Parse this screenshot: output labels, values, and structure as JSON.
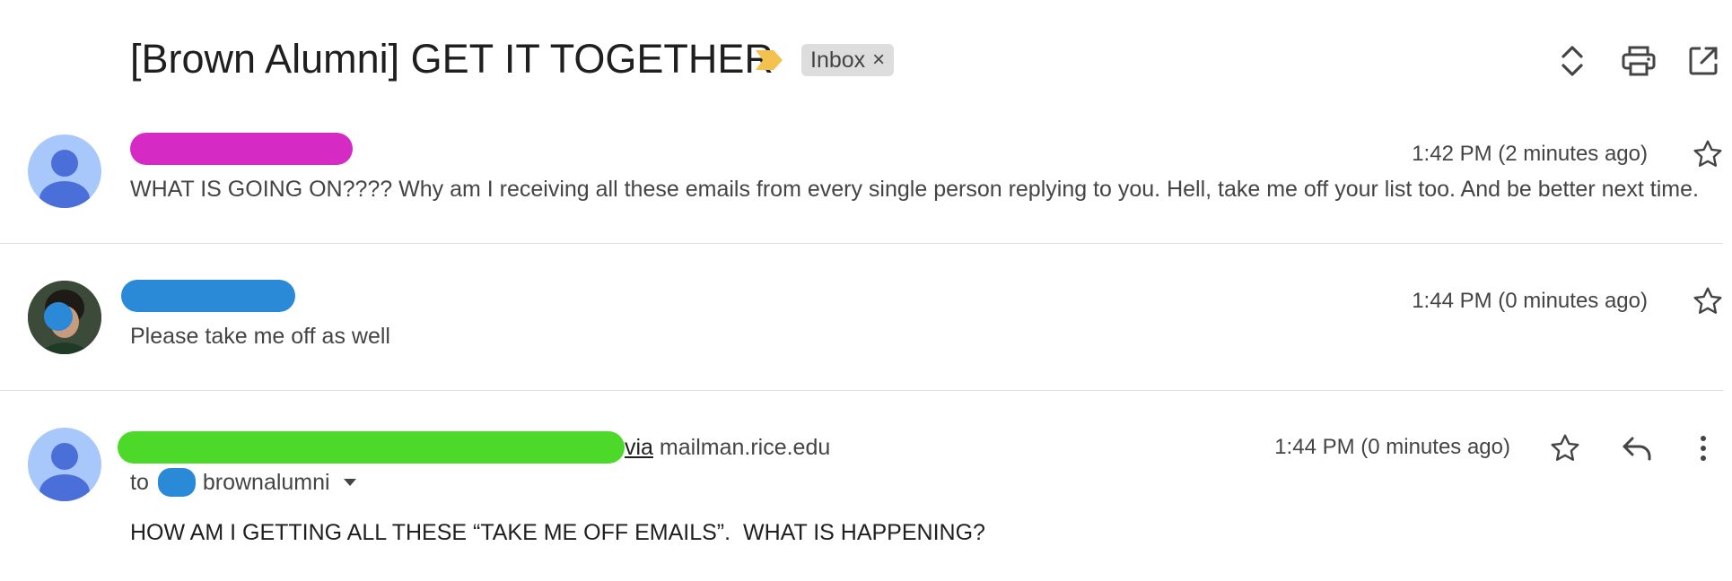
{
  "thread": {
    "subject": "[Brown Alumni] GET IT TOGETHER",
    "label": "Inbox",
    "label_remove": "×",
    "label_arrow_color": "#f2c14e"
  },
  "toolbar": {
    "expand_icon": "unfold-more-icon",
    "print_icon": "print-icon",
    "open_new_window_icon": "open-in-new-icon"
  },
  "messages": [
    {
      "sender_redaction_color": "#d62ac4",
      "time": "1:42 PM (2 minutes ago)",
      "snippet": "WHAT IS GOING ON???? Why am I receiving all these emails from every single person replying to you. Hell, take me off your list too. And be better next time."
    },
    {
      "sender_redaction_color": "#2a8ad8",
      "time": "1:44 PM (0 minutes ago)",
      "snippet": "Please take me off as well"
    },
    {
      "sender_redaction_color": "#4cd92a",
      "via_word": "via",
      "via_domain": " mailman.rice.edu",
      "time": "1:44 PM (0 minutes ago)",
      "to_prefix": "to",
      "to_name": "brownalumni",
      "body": "HOW AM I GETTING ALL THESE “TAKE ME OFF EMAILS”.  WHAT IS HAPPENING?"
    }
  ],
  "colors": {
    "avatar_bg": "#a8c7fa",
    "avatar_fg": "#4a6fd8"
  }
}
